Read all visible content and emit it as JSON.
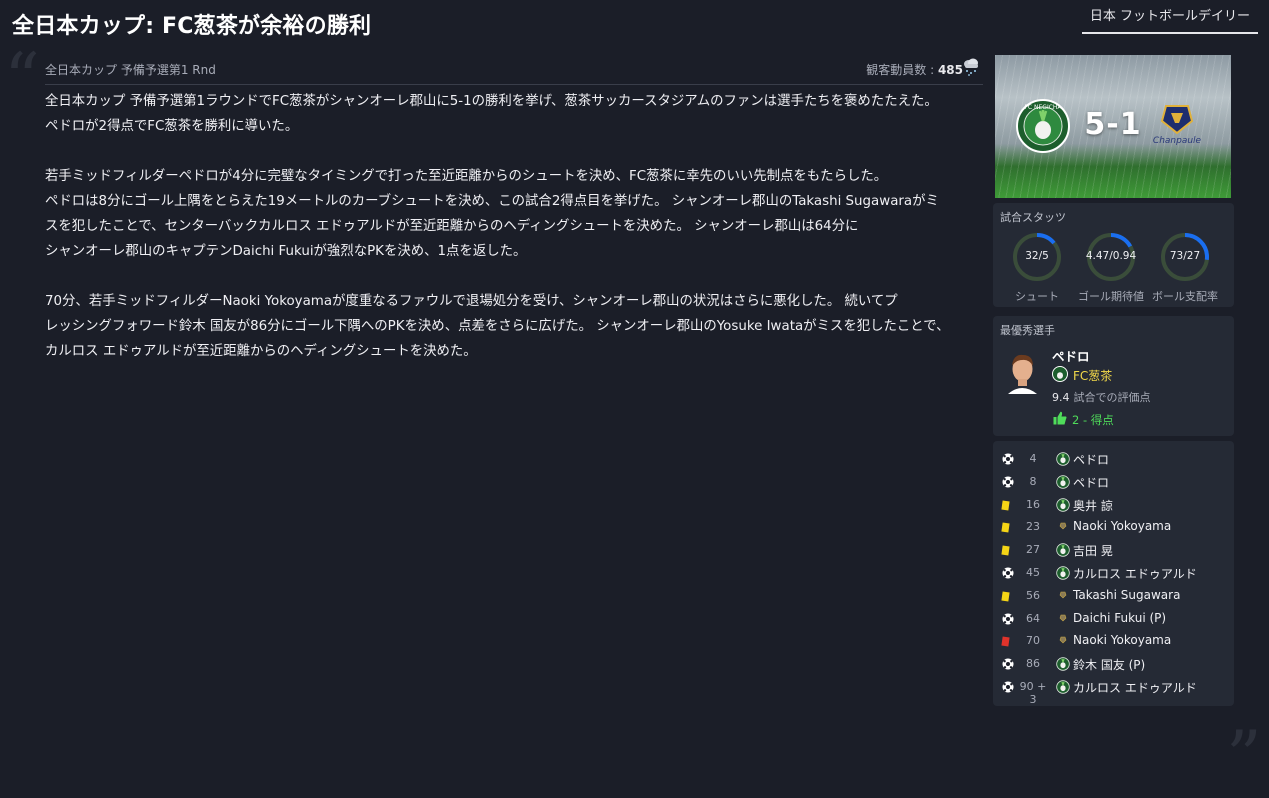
{
  "headline": "全日本カップ: FC葱茶が余裕の勝利",
  "source": "日本 フットボールデイリー",
  "meta": {
    "competition": "全日本カップ 予備予選第1 Rnd",
    "attendance_label": "観客動員数 :",
    "attendance_value": "485",
    "weather_icon": "snow-cloud-icon"
  },
  "article": {
    "p1": [
      "全日本カップ 予備予選第1ラウンドでFC葱茶がシャンオーレ郡山に5-1の勝利を挙げ、葱茶サッカースタジアムのファンは選手たちを褒めたたえた。",
      "ペドロが2得点でFC葱茶を勝利に導いた。"
    ],
    "p2": [
      "若手ミッドフィルダーペドロが4分に完璧なタイミングで打った至近距離からのシュートを決め、FC葱茶に幸先のいい先制点をもたらした。",
      "ペドロは8分にゴール上隅をとらえた19メートルのカーブシュートを決め、この試合2得点目を挙げた。 シャンオーレ郡山のTakashi Sugawaraがミ",
      "スを犯したことで、センターバックカルロス エドゥアルドが至近距離からのヘディングシュートを決めた。 シャンオーレ郡山は64分に",
      "シャンオーレ郡山のキャプテンDaichi Fukuiが強烈なPKを決め、1点を返した。"
    ],
    "p3": [
      "70分、若手ミッドフィルダーNaoki Yokoyamaが度重なるファウルで退場処分を受け、シャンオーレ郡山の状況はさらに悪化した。 続いてプ",
      "レッシングフォワード鈴木 国友が86分にゴール下隅へのPKを決め、点差をさらに広げた。 シャンオーレ郡山のYosuke Iwataがミスを犯したことで、",
      "カルロス エドゥアルドが至近距離からのヘディングシュートを決めた。"
    ]
  },
  "score": {
    "text": "5-1",
    "home_score": 5,
    "away_score": 1,
    "home_crest_text": "FC NEGICHA",
    "away_crest_text": "Chanpaule"
  },
  "stats": {
    "title": "試合スタッツ",
    "items": [
      {
        "label": "シュート",
        "value": "32/5",
        "home_share": 0.86
      },
      {
        "label": "ゴール期待値",
        "value": "4.47/0.94",
        "home_share": 0.83
      },
      {
        "label": "ボール支配率",
        "value": "73/27",
        "home_share": 0.73
      }
    ],
    "home_color": "#1a6ef0",
    "away_color": "#3a4d3a"
  },
  "potm": {
    "title": "最優秀選手",
    "name": "ペドロ",
    "team": "FC葱茶",
    "rating": "9.4",
    "rating_label": "試合での評価点",
    "goals": "2 - 得点"
  },
  "events": [
    {
      "type": "goal",
      "minute": "4",
      "team": "home",
      "name": "ペドロ"
    },
    {
      "type": "goal",
      "minute": "8",
      "team": "home",
      "name": "ペドロ"
    },
    {
      "type": "yellow",
      "minute": "16",
      "team": "home",
      "name": "奥井 諒"
    },
    {
      "type": "yellow",
      "minute": "23",
      "team": "away",
      "name": "Naoki Yokoyama"
    },
    {
      "type": "yellow",
      "minute": "27",
      "team": "home",
      "name": "吉田 晃"
    },
    {
      "type": "goal",
      "minute": "45",
      "team": "home",
      "name": "カルロス エドゥアルド"
    },
    {
      "type": "yellow",
      "minute": "56",
      "team": "away",
      "name": "Takashi Sugawara"
    },
    {
      "type": "goal",
      "minute": "64",
      "team": "away",
      "name": "Daichi Fukui (P)"
    },
    {
      "type": "red",
      "minute": "70",
      "team": "away",
      "name": "Naoki Yokoyama"
    },
    {
      "type": "goal",
      "minute": "86",
      "team": "home",
      "name": "鈴木 国友 (P)"
    },
    {
      "type": "goal",
      "minute": "90 + 3",
      "team": "home",
      "name": "カルロス エドゥアルド"
    }
  ]
}
